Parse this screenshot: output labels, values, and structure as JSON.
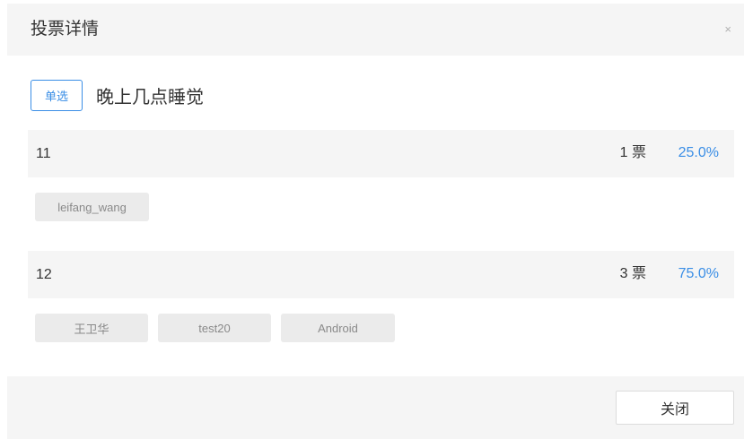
{
  "dialog": {
    "title": "投票详情",
    "close_icon": "×",
    "close_button": "关闭"
  },
  "question": {
    "type_badge": "单选",
    "text": "晚上几点睡觉"
  },
  "options": [
    {
      "label": "11",
      "votes": "1 票",
      "percent": "25.0%",
      "voters": [
        "leifang_wang"
      ]
    },
    {
      "label": "12",
      "votes": "3 票",
      "percent": "75.0%",
      "voters": [
        "王卫华",
        "test20",
        "Android"
      ]
    }
  ],
  "colors": {
    "accent": "#3a8ee6",
    "panel_bg": "#f5f5f5",
    "chip_bg": "#ebebeb"
  }
}
